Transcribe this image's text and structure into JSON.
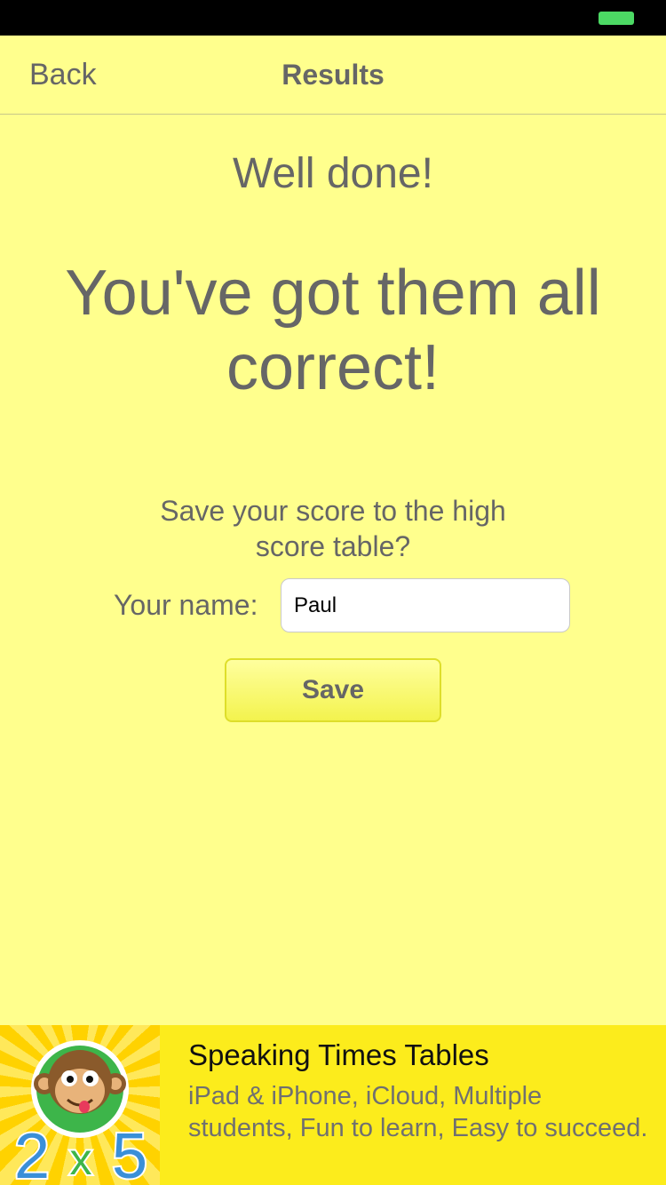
{
  "nav": {
    "back_label": "Back",
    "title": "Results"
  },
  "result": {
    "congrats": "Well done!",
    "headline": "You've got them all correct!"
  },
  "save_form": {
    "prompt": "Save your score to the high score table?",
    "name_label": "Your name:",
    "name_value": "Paul",
    "save_label": "Save"
  },
  "ad": {
    "title": "Speaking Times Tables",
    "description": "iPad & iPhone, iCloud, Multiple students, Fun to learn, Easy to succeed.",
    "icon_name": "monkey-2x5-app-icon",
    "icon_text": {
      "left": "2",
      "middle": "x",
      "right": "5"
    }
  },
  "colors": {
    "background": "#ffff8d",
    "text": "#666666",
    "ad_background": "#fcec1c",
    "battery": "#4cd964",
    "icon_digits": "#3a8fd8",
    "icon_times": "#3db54a"
  }
}
